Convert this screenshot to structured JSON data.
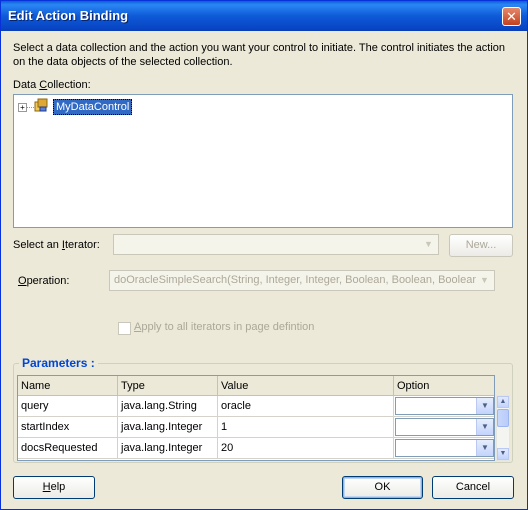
{
  "window": {
    "title": "Edit Action Binding",
    "close_symbol": "✕"
  },
  "description": "Select a data collection and the action you want your control to initiate. The control initiates the action on the data objects of the selected collection.",
  "data_collection": {
    "label_pre": "Data ",
    "label_key": "C",
    "label_post": "ollection:",
    "tree_expander": "+",
    "tree_item": "MyDataControl"
  },
  "iterator": {
    "label_pre": "Select an ",
    "label_key": "I",
    "label_post": "terator:",
    "value": "",
    "new_button": "New..."
  },
  "operation": {
    "label_pre": "",
    "label_key": "O",
    "label_post": "peration:",
    "value": "doOracleSimpleSearch(String, Integer, Integer, Boolean, Boolean, Boolean)"
  },
  "apply_all": {
    "label_key": "A",
    "label_post": "pply to all iterators in page defintion",
    "checked": false
  },
  "parameters": {
    "title": "Parameters :",
    "columns": [
      "Name",
      "Type",
      "Value",
      "Option"
    ],
    "rows": [
      {
        "name": "query",
        "type": "java.lang.String",
        "value": "oracle",
        "option": ""
      },
      {
        "name": "startIndex",
        "type": "java.lang.Integer",
        "value": "1",
        "option": ""
      },
      {
        "name": "docsRequested",
        "type": "java.lang.Integer",
        "value": "20",
        "option": ""
      }
    ]
  },
  "footer": {
    "help_key": "H",
    "help_post": "elp",
    "ok": "OK",
    "cancel": "Cancel"
  },
  "colors": {
    "title_bar": "#0a5fd8",
    "dialog_bg": "#ece9d8",
    "selection": "#316ac5",
    "group_title": "#0046d5"
  },
  "icons": {
    "close": "close-icon",
    "data-control": "data-control-icon",
    "dropdown": "chevron-down-icon"
  }
}
